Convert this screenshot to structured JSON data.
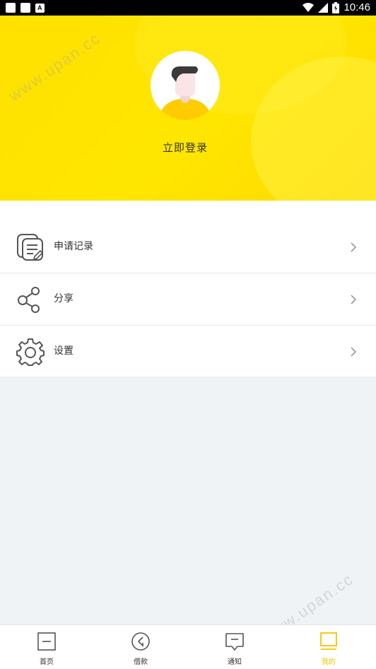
{
  "status_bar": {
    "time": "10:46"
  },
  "header": {
    "login_label": "立即登录",
    "watermark_text": "www.upan.cc",
    "background_color": "#ffe400"
  },
  "menu": {
    "items": [
      {
        "label": "申请记录",
        "icon": "document-list-icon"
      },
      {
        "label": "分享",
        "icon": "share-icon"
      },
      {
        "label": "设置",
        "icon": "gear-icon"
      }
    ]
  },
  "tabbar": {
    "active_color": "#f2c400",
    "tabs": [
      {
        "label": "首页",
        "icon": "home-square-icon"
      },
      {
        "label": "借款",
        "icon": "loan-circle-icon"
      },
      {
        "label": "通知",
        "icon": "message-icon"
      },
      {
        "label": "我的",
        "icon": "profile-screen-icon",
        "active": true
      }
    ]
  }
}
